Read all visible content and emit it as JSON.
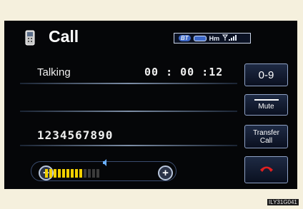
{
  "header": {
    "title": "Call",
    "status": {
      "bt": "BT",
      "hm": "Hm"
    }
  },
  "call": {
    "status_label": "Talking",
    "timer": "00 : 00 :12",
    "phone_number": "1234567890"
  },
  "buttons": {
    "keypad": "0-9",
    "mute": "Mute",
    "transfer_line1": "Transfer",
    "transfer_line2": "Call"
  },
  "volume": {
    "minus": "−",
    "plus": "+",
    "level": 0.7,
    "segments": 13
  },
  "footer": {
    "code": "ILY31G041"
  },
  "colors": {
    "accent_blue": "#3d68c8",
    "volume_on": "#f2d000",
    "end_call_red": "#e02020"
  }
}
